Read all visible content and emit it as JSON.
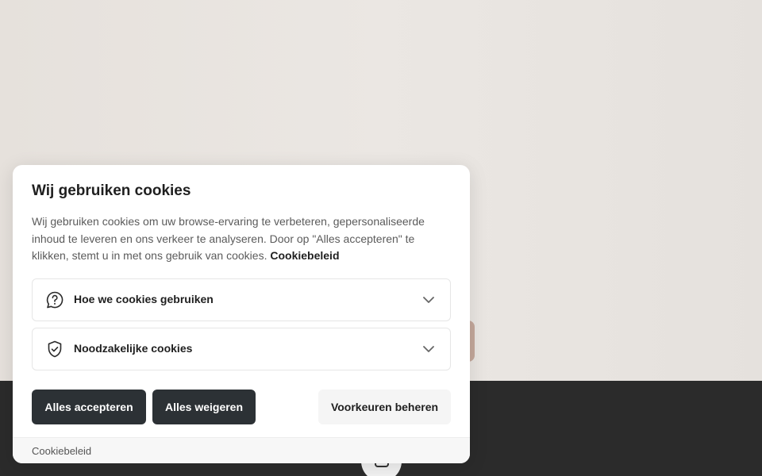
{
  "banner": {
    "title": "Wij gebruiken cookies",
    "description": "Wij gebruiken cookies om uw browse-ervaring te verbeteren, gepersonaliseerde inhoud te leveren en ons verkeer te analyseren. Door op \"Alles accepteren\" te klikken, stemt u in met ons gebruik van cookies.",
    "policy_link": "Cookiebeleid",
    "sections": [
      {
        "label": "Hoe we cookies gebruiken",
        "icon": "question-bubble-icon"
      },
      {
        "label": "Noodzakelijke cookies",
        "icon": "shield-check-icon"
      }
    ],
    "buttons": {
      "accept_all": "Alles accepteren",
      "reject_all": "Alles weigeren",
      "manage_preferences": "Voorkeuren beheren"
    },
    "footer_link": "Cookiebeleid"
  },
  "colors": {
    "primary_button": "#2c3135",
    "secondary_button": "#f5f5f5",
    "page_dark": "#2b2b2b",
    "page_light": "#e9e5e1"
  },
  "icons": {
    "chevron": "chevron-down-icon",
    "floating_button": "settings-icon"
  }
}
